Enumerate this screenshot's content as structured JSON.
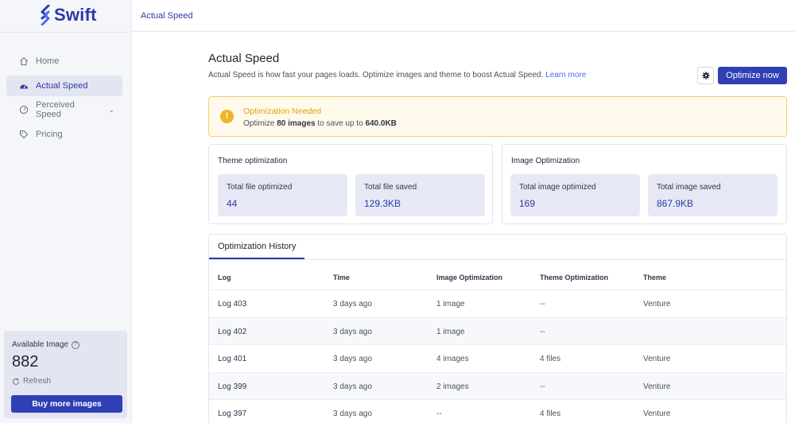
{
  "app": {
    "logo_text": "Swift",
    "brand_color": "#2b3aa8"
  },
  "topbar": {
    "breadcrumb": "Actual Speed"
  },
  "sidebar": {
    "items": [
      {
        "label": "Home",
        "icon": "home-icon"
      },
      {
        "label": "Actual Speed",
        "icon": "speedometer-icon",
        "active": true
      },
      {
        "label": "Perceived Speed",
        "icon": "gauge-icon",
        "has_submenu": true
      },
      {
        "label": "Pricing",
        "icon": "tag-icon"
      }
    ],
    "available": {
      "title": "Available Image",
      "count": "882",
      "refresh_label": "Refresh",
      "buy_label": "Buy more images"
    }
  },
  "page": {
    "title": "Actual Speed",
    "description": "Actual Speed is how fast your pages loads. Optimize images and theme to boost Actual Speed.",
    "learn_more": "Learn more",
    "optimize_label": "Optimize now"
  },
  "alert": {
    "title": "Optimization Needed",
    "text_prefix": "Optimize",
    "images": "80 images",
    "text_middle": "to save up to",
    "size": "640.0KB"
  },
  "theme_card": {
    "title": "Theme optimization",
    "stats": [
      {
        "label": "Total file optimized",
        "value": "44"
      },
      {
        "label": "Total file saved",
        "value": "129.3KB"
      }
    ]
  },
  "image_card": {
    "title": "Image Optimization",
    "stats": [
      {
        "label": "Total image optimized",
        "value": "169"
      },
      {
        "label": "Total image saved",
        "value": "867.9KB"
      }
    ]
  },
  "history": {
    "tab": "Optimization History",
    "columns": [
      "Log",
      "Time",
      "Image Optimization",
      "Theme Optimization",
      "Theme"
    ],
    "rows": [
      [
        "Log 403",
        "3 days ago",
        "1 image",
        "--",
        "Venture"
      ],
      [
        "Log 402",
        "3 days ago",
        "1 image",
        "--",
        ""
      ],
      [
        "Log 401",
        "3 days ago",
        "4 images",
        "4 files",
        "Venture"
      ],
      [
        "Log 399",
        "3 days ago",
        "2 images",
        "--",
        "Venture"
      ],
      [
        "Log 397",
        "3 days ago",
        "--",
        "4 files",
        "Venture"
      ]
    ]
  }
}
